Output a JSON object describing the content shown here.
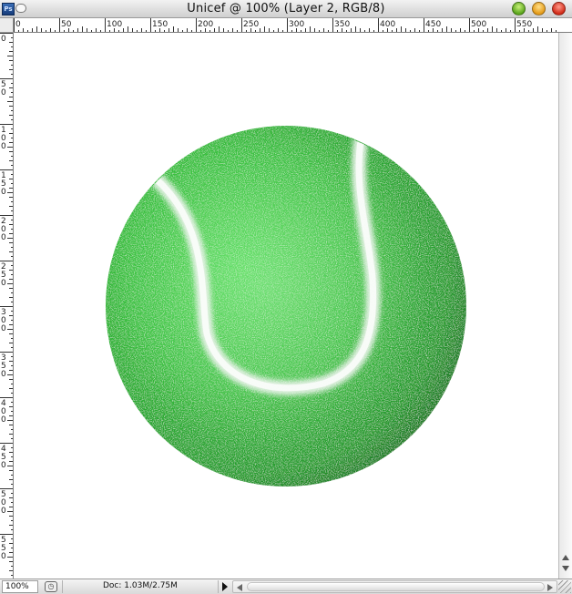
{
  "window": {
    "app_icon_text": "Ps",
    "title": "Unicef @ 100% (Layer 2, RGB/8)"
  },
  "rulers": {
    "horizontal_labels": [
      "0",
      "50",
      "100",
      "150",
      "200",
      "250",
      "300",
      "350",
      "400",
      "450",
      "500",
      "550"
    ],
    "vertical_labels": [
      "0",
      "50",
      "100",
      "150",
      "200",
      "250",
      "300",
      "350",
      "400",
      "450",
      "500",
      "550"
    ]
  },
  "canvas": {
    "document_name": "Unicef",
    "layer": "Layer 2",
    "ball_color": "#3cc23c",
    "ball_shadow_color": "#1f7a24",
    "seam_color": "#f2f2f2"
  },
  "status": {
    "zoom": "100%",
    "doc_info": "Doc: 1.03M/2.75M"
  }
}
